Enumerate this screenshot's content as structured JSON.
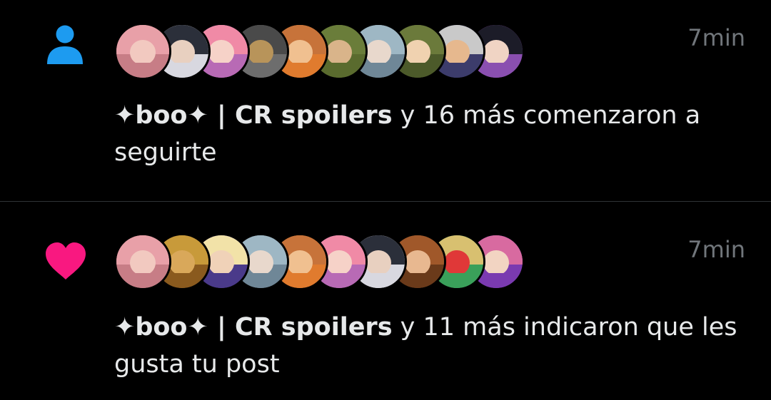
{
  "notifications": [
    {
      "type": "follow",
      "icon": "person-icon",
      "icon_color": "#1d9bf0",
      "time": "7min",
      "actor": "✦boo✦ | CR spoilers",
      "message": " y 16 más comenzaron a seguirte",
      "avatars": [
        {
          "hair": "#e8a0a8",
          "face": "#f2c9c0",
          "cloth": "#c77d86"
        },
        {
          "hair": "#2b2f3a",
          "face": "#e8d0c0",
          "cloth": "#d8d8e0"
        },
        {
          "hair": "#f08aa6",
          "face": "#f6d2c8",
          "cloth": "#b86ab5"
        },
        {
          "hair": "#4a4a4a",
          "face": "#b8945a",
          "cloth": "#6d6d6d"
        },
        {
          "hair": "#c7733a",
          "face": "#f0c090",
          "cloth": "#e07b2e"
        },
        {
          "hair": "#6a7d3a",
          "face": "#d9b48a",
          "cloth": "#5a6b2e"
        },
        {
          "hair": "#9eb7c4",
          "face": "#e8d8cc",
          "cloth": "#6f8797"
        },
        {
          "hair": "#6b7a3b",
          "face": "#f0d2b0",
          "cloth": "#4c5a2a"
        },
        {
          "hair": "#c9c9c9",
          "face": "#e6b88e",
          "cloth": "#3c3c6b"
        },
        {
          "hair": "#1c1c28",
          "face": "#f0d4c4",
          "cloth": "#8a4fb0"
        }
      ]
    },
    {
      "type": "like",
      "icon": "heart-icon",
      "icon_color": "#f91880",
      "time": "7min",
      "actor": "✦boo✦ | CR spoilers",
      "message": " y 11 más indicaron que les gusta tu post",
      "avatars": [
        {
          "hair": "#e8a0a8",
          "face": "#f2c9c0",
          "cloth": "#c77d86"
        },
        {
          "hair": "#c89a3a",
          "face": "#d9a85a",
          "cloth": "#8a5a1e"
        },
        {
          "hair": "#f2e2a8",
          "face": "#f0d2b8",
          "cloth": "#4a3a8a"
        },
        {
          "hair": "#9eb7c4",
          "face": "#e8d8cc",
          "cloth": "#6f8797"
        },
        {
          "hair": "#c7733a",
          "face": "#f0c090",
          "cloth": "#e07b2e"
        },
        {
          "hair": "#f08aa6",
          "face": "#f6d2c8",
          "cloth": "#b86ab5"
        },
        {
          "hair": "#2b2f3a",
          "face": "#e8d0c0",
          "cloth": "#d8d8e0"
        },
        {
          "hair": "#a0582a",
          "face": "#e8b890",
          "cloth": "#6a3a1a"
        },
        {
          "hair": "#d8c070",
          "face": "#e03838",
          "cloth": "#3aa05a"
        },
        {
          "hair": "#d86aa0",
          "face": "#f2d4c2",
          "cloth": "#7a3ab0"
        }
      ]
    }
  ]
}
